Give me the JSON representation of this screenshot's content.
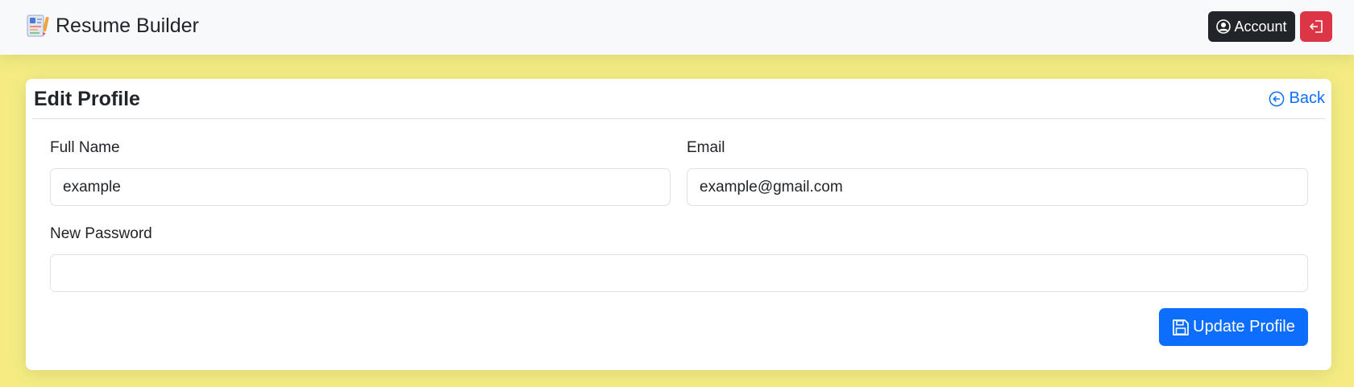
{
  "app": {
    "brand_name": "Resume Builder",
    "logo_icon": "resume-logo-icon"
  },
  "navbar": {
    "account_label": "Account",
    "account_icon": "user-circle-icon",
    "logout_icon": "sign-out-icon"
  },
  "page": {
    "title": "Edit Profile",
    "back_label": "Back",
    "back_icon": "arrow-left-circle-icon"
  },
  "form": {
    "full_name": {
      "label": "Full Name",
      "value": "example"
    },
    "email": {
      "label": "Email",
      "value": "example@gmail.com"
    },
    "new_password": {
      "label": "New Password",
      "value": ""
    },
    "submit_label": "Update Profile",
    "submit_icon": "save-icon"
  },
  "colors": {
    "background": "#f4ec83",
    "navbar": "#f8f9fa",
    "primary": "#0d6efd",
    "danger": "#dc3545",
    "dark": "#212529"
  }
}
